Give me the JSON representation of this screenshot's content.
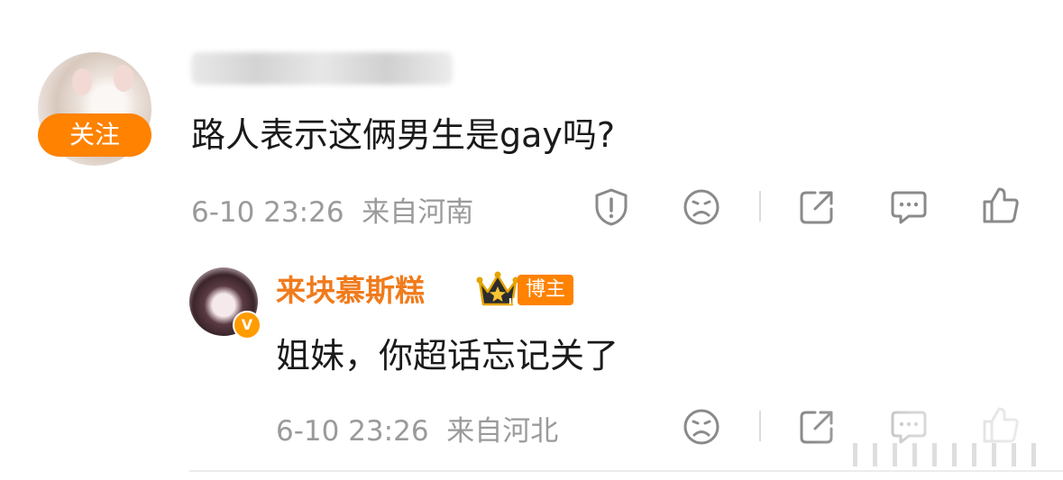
{
  "comment1": {
    "follow_label": "关注",
    "text": "路人表示这俩男生是gay吗?",
    "time": "6-10 23:26",
    "location": "来自河南",
    "icons": [
      "report-icon",
      "dislike-icon",
      "share-icon",
      "comment-icon",
      "like-icon"
    ]
  },
  "reply": {
    "username": "来块慕斯糕",
    "verified_badge": "V",
    "crown_level": "II",
    "tag": "博主",
    "text": "姐妹，你超话忘记关了",
    "time": "6-10 23:26",
    "location": "来自河北",
    "icons": [
      "dislike-icon",
      "share-icon",
      "comment-icon",
      "like-icon"
    ]
  },
  "colors": {
    "accent": "#ff8200",
    "username": "#f07b1c",
    "meta": "#9a9a9a",
    "icon": "#8a8a8a"
  }
}
